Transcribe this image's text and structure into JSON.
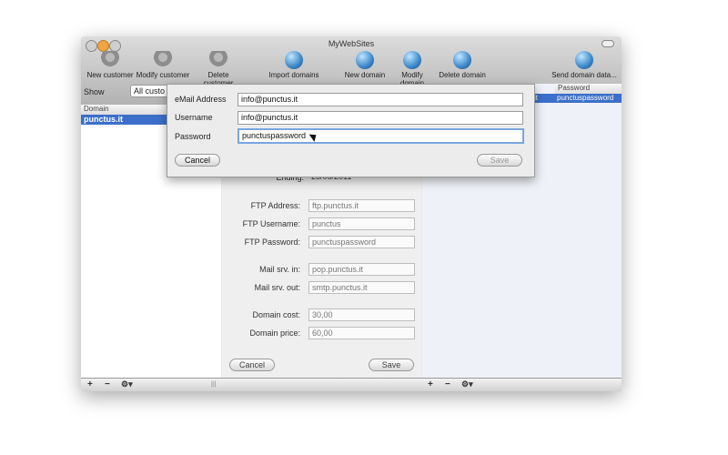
{
  "window": {
    "title": "MyWebSites"
  },
  "toolbar": {
    "new_customer": "New  customer",
    "modify_customer": "Modify customer",
    "delete_customer": "Delete customer",
    "import_domains": "Import domains",
    "new_domain": "New domain",
    "modify_domain": "Modify domain",
    "delete_domain": "Delete domain",
    "send_domain_data": "Send domain data..."
  },
  "left": {
    "show_label": "Show",
    "filter_value": "All custo",
    "column_header": "Domain",
    "rows": [
      "punctus.it"
    ]
  },
  "middle": {
    "ending_label": "Ending:",
    "ending_value": "25/06/2011",
    "ftp_address_label": "FTP Address:",
    "ftp_address_value": "ftp.punctus.it",
    "ftp_username_label": "FTP Username:",
    "ftp_username_value": "punctus",
    "ftp_password_label": "FTP Password:",
    "ftp_password_value": "punctuspassword",
    "mail_in_label": "Mail srv. in:",
    "mail_in_value": "pop.punctus.it",
    "mail_out_label": "Mail srv. out:",
    "mail_out_value": "smtp.punctus.it",
    "domain_cost_label": "Domain cost:",
    "domain_cost_value": "30,00",
    "domain_price_label": "Domain price:",
    "domain_price_value": "60,00",
    "cancel_label": "Cancel",
    "save_label": "Save"
  },
  "right": {
    "column_header": "Password",
    "row_prefix": "it",
    "row_value": "punctuspassword"
  },
  "sheet": {
    "email_label": "eMail Address",
    "email_value": "info@punctus.it",
    "username_label": "Username",
    "username_value": "info@punctus.it",
    "password_label": "Password",
    "password_value": "punctuspassword",
    "cancel_label": "Cancel",
    "save_label": "Save"
  },
  "bottombar": {
    "add": "+",
    "remove": "−",
    "action": "⚙▾",
    "grip": "|||"
  },
  "colors": {
    "selection": "#3c6fc9",
    "focus_ring": "#7aa6dd"
  },
  "icons": [
    "person-add-icon",
    "person-edit-icon",
    "person-delete-icon",
    "globe-import-icon",
    "globe-add-icon",
    "globe-edit-icon",
    "globe-delete-icon",
    "globe-send-icon"
  ]
}
